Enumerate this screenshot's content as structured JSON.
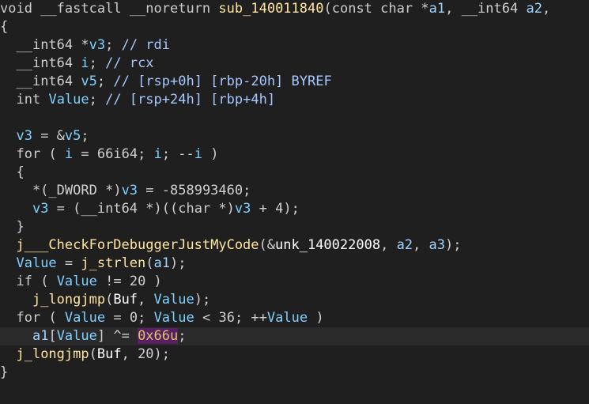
{
  "code": {
    "lines": [
      "void __fastcall __noreturn sub_140011840(const char *a1, __int64 a2,",
      "{",
      "  __int64 *v3; // rdi",
      "  __int64 i; // rcx",
      "  __int64 v5; // [rsp+0h] [rbp-20h] BYREF",
      "  int Value; // [rsp+24h] [rbp+4h]",
      "",
      "  v3 = &v5;",
      "  for ( i = 66i64; i; --i )",
      "  {",
      "    *(_DWORD *)v3 = -858993460;",
      "    v3 = (__int64 *)((char *)v3 + 4);",
      "  }",
      "  j___CheckForDebuggerJustMyCode(&unk_140022008, a2, a3);",
      "  Value = j_strlen(a1);",
      "  if ( Value != 20 )",
      "    j_longjmp(Buf, Value);",
      "  for ( Value = 0; Value < 36; ++Value )",
      "    a1[Value] ^= 0x66u;",
      "  j_longjmp(Buf, 20);",
      "}"
    ],
    "highlighted_line": 18,
    "cursor_token": "0x66u"
  }
}
